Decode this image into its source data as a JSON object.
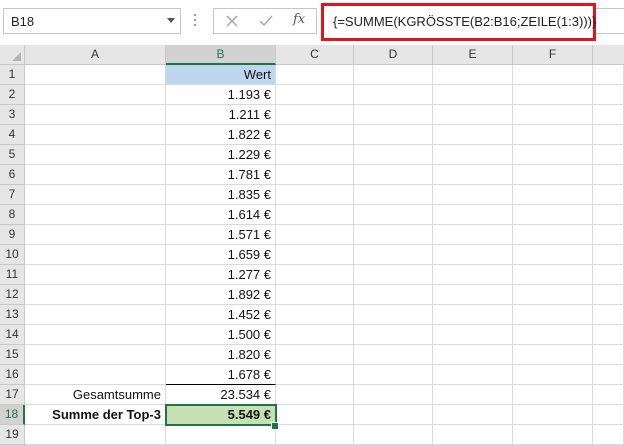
{
  "name_box": {
    "value": "B18"
  },
  "formula_bar": {
    "fx_label": "fx",
    "formula": "{=SUMME(KGRÖSSTE(B2:B16;ZEILE(1:3)))}",
    "highlight_color": "#e0141e"
  },
  "columns": [
    "A",
    "B",
    "C",
    "D",
    "E",
    "F"
  ],
  "rows": [
    "1",
    "2",
    "3",
    "4",
    "5",
    "6",
    "7",
    "8",
    "9",
    "10",
    "11",
    "12",
    "13",
    "14",
    "15",
    "16",
    "17",
    "18",
    "19"
  ],
  "selected_cell": {
    "column": "B",
    "row": "18"
  },
  "sheet": {
    "header_value": "Wert",
    "values": [
      "1.193 €",
      "1.211 €",
      "1.822 €",
      "1.229 €",
      "1.781 €",
      "1.835 €",
      "1.614 €",
      "1.571 €",
      "1.659 €",
      "1.277 €",
      "1.892 €",
      "1.452 €",
      "1.500 €",
      "1.820 €",
      "1.678 €"
    ],
    "total_label": "Gesamtsumme",
    "total_value": "23.534 €",
    "top3_label": "Summe der Top-3",
    "top3_value": "5.549 €"
  },
  "colors": {
    "header_fill": "#bdd7ee",
    "result_fill": "#c6e0b4",
    "selection": "#217346"
  }
}
